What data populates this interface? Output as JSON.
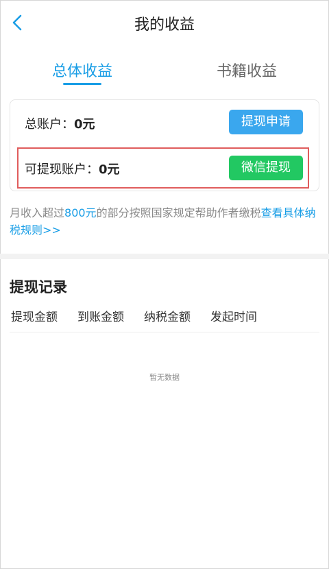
{
  "header": {
    "title": "我的收益",
    "back_icon": "chevron-left-icon"
  },
  "tabs": [
    {
      "label": "总体收益",
      "active": true
    },
    {
      "label": "书籍收益",
      "active": false
    }
  ],
  "accounts": {
    "total": {
      "label": "总账户：",
      "value": "0元",
      "button": "提现申请"
    },
    "withdrawable": {
      "label": "可提现账户：",
      "value": "0元",
      "button": "微信提现"
    }
  },
  "tax_note": {
    "prefix": "月收入超过",
    "amount": "800元",
    "middle": "的部分按照国家规定帮助作者缴税",
    "link": "查看具体纳税规则>>"
  },
  "records": {
    "title": "提现记录",
    "columns": [
      "提现金额",
      "到账金额",
      "纳税金额",
      "发起时间"
    ],
    "empty_text": "暂无数据"
  },
  "colors": {
    "accent": "#1a9ee6",
    "button_blue": "#3aa7ee",
    "button_green": "#22c862",
    "highlight_red": "#e05c5c"
  }
}
